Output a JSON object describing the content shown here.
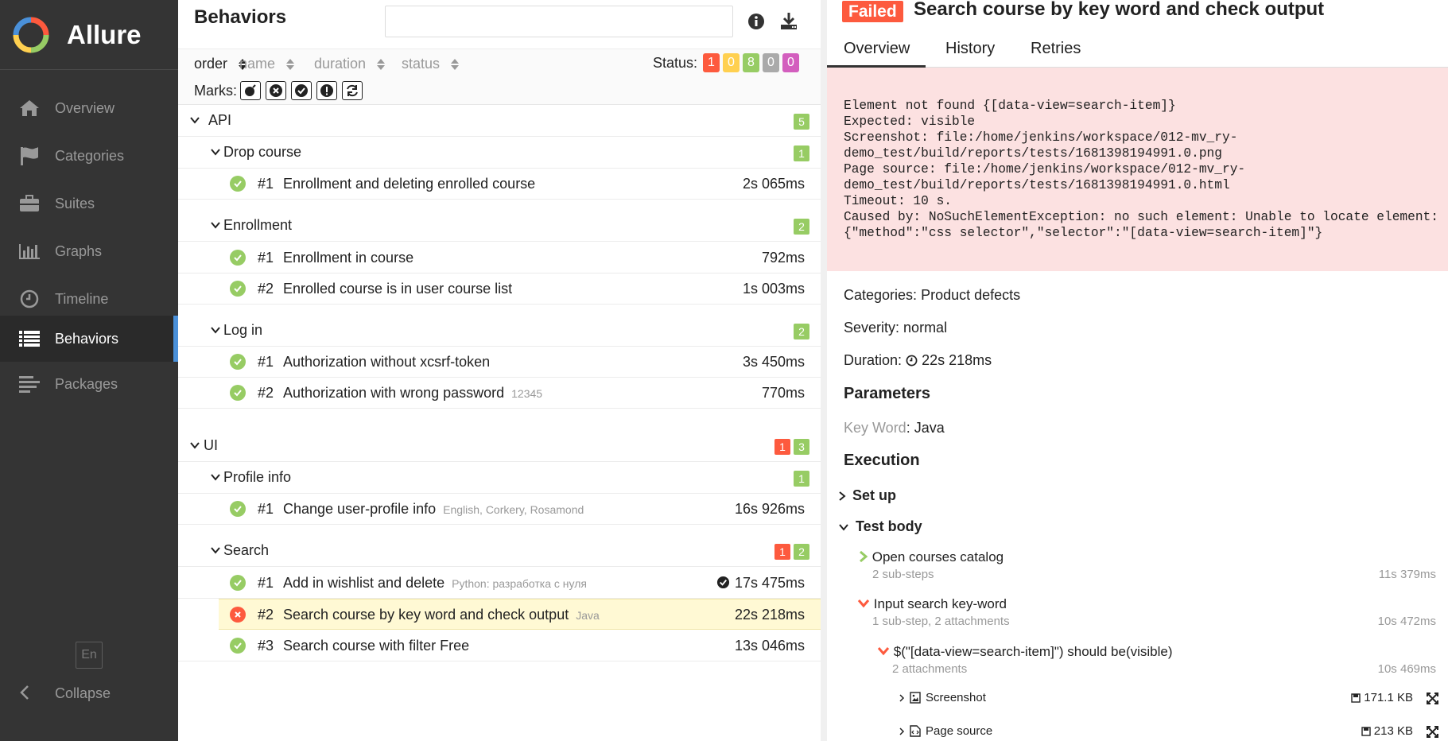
{
  "app": {
    "name": "Allure"
  },
  "sidebar": {
    "items": [
      {
        "label": "Overview",
        "icon": "home-icon"
      },
      {
        "label": "Categories",
        "icon": "flag-icon"
      },
      {
        "label": "Suites",
        "icon": "briefcase-icon"
      },
      {
        "label": "Graphs",
        "icon": "bar-chart-icon"
      },
      {
        "label": "Timeline",
        "icon": "clock-icon"
      },
      {
        "label": "Behaviors",
        "icon": "list-icon",
        "active": true
      },
      {
        "label": "Packages",
        "icon": "align-left-icon"
      }
    ],
    "language": "En",
    "collapse_label": "Collapse"
  },
  "tree": {
    "title": "Behaviors",
    "search": {
      "value": "",
      "placeholder": ""
    },
    "sort": {
      "order": "order",
      "name": "name",
      "duration": "duration",
      "status": "status"
    },
    "status_label": "Status:",
    "status_counts": [
      {
        "count": "1",
        "color": "#fd5a3e"
      },
      {
        "count": "0",
        "color": "#ffd050"
      },
      {
        "count": "8",
        "color": "#97cc64"
      },
      {
        "count": "0",
        "color": "#aaaaaa"
      },
      {
        "count": "0",
        "color": "#d35ebe"
      }
    ],
    "marks_label": "Marks:",
    "groups": [
      {
        "name": "API",
        "badges": [
          "5"
        ]
      },
      {
        "name": "Drop course",
        "badges": [
          "1"
        ]
      },
      {
        "name": "Enrollment",
        "badges": [
          "2"
        ]
      },
      {
        "name": "Log in",
        "badges": [
          "2"
        ]
      },
      {
        "name": "UI",
        "badges": [
          "1",
          "3"
        ]
      },
      {
        "name": "Profile info",
        "badges": [
          "1"
        ]
      },
      {
        "name": "Search",
        "badges": [
          "1",
          "2"
        ]
      }
    ],
    "tests": [
      {
        "num": "#1",
        "name": "Enrollment and deleting enrolled course",
        "param": "",
        "duration": "2s 065ms"
      },
      {
        "num": "#1",
        "name": "Enrollment in course",
        "param": "",
        "duration": "792ms"
      },
      {
        "num": "#2",
        "name": "Enrolled course is in user course list",
        "param": "",
        "duration": "1s 003ms"
      },
      {
        "num": "#1",
        "name": "Authorization without xcsrf-token",
        "param": "",
        "duration": "3s 450ms"
      },
      {
        "num": "#2",
        "name": "Authorization with wrong password",
        "param": "12345",
        "duration": "770ms"
      },
      {
        "num": "#1",
        "name": "Change user-profile info",
        "param": "English, Corkery, Rosamond",
        "duration": "16s 926ms"
      },
      {
        "num": "#1",
        "name": "Add in wishlist and delete",
        "param": "Python: разработка с нуля",
        "duration": "17s 475ms"
      },
      {
        "num": "#2",
        "name": "Search course by key word and check output",
        "param": "Java",
        "duration": "22s 218ms",
        "status": "failed"
      },
      {
        "num": "#3",
        "name": "Search course with filter Free",
        "param": "",
        "duration": "13s 046ms"
      }
    ]
  },
  "details": {
    "status": "Failed",
    "title": "Search course by key word and check output",
    "tabs": [
      "Overview",
      "History",
      "Retries"
    ],
    "error": "Element not found {[data-view=search-item]}\nExpected: visible\nScreenshot: file:/home/jenkins/workspace/012-mv_ry-\ndemo_test/build/reports/tests/1681398194991.0.png\nPage source: file:/home/jenkins/workspace/012-mv_ry-\ndemo_test/build/reports/tests/1681398194991.0.html\nTimeout: 10 s.\nCaused by: NoSuchElementException: no such element: Unable to locate element:\n{\"method\":\"css selector\",\"selector\":\"[data-view=search-item]\"}",
    "categories_label": "Categories:",
    "categories": "Product defects",
    "severity_label": "Severity:",
    "severity": "normal",
    "duration_label": "Duration:",
    "duration": "22s 218ms",
    "parameters_heading": "Parameters",
    "param_key": "Key Word",
    "param_value": "Java",
    "execution_heading": "Execution",
    "setup_label": "Set up",
    "test_body_label": "Test body",
    "steps": [
      {
        "name": "Open courses catalog",
        "sub": "2 sub-steps",
        "duration": "11s 379ms"
      },
      {
        "name": "Input search key-word",
        "sub": "1 sub-step, 2 attachments",
        "duration": "10s 472ms"
      },
      {
        "name": "$(\"[data-view=search-item]\") should be(visible)",
        "sub": "2 attachments",
        "duration": "10s 469ms"
      }
    ],
    "attachments": [
      {
        "name": "Screenshot",
        "size": "171.1 KB"
      },
      {
        "name": "Page source",
        "size": "213 KB"
      }
    ]
  }
}
